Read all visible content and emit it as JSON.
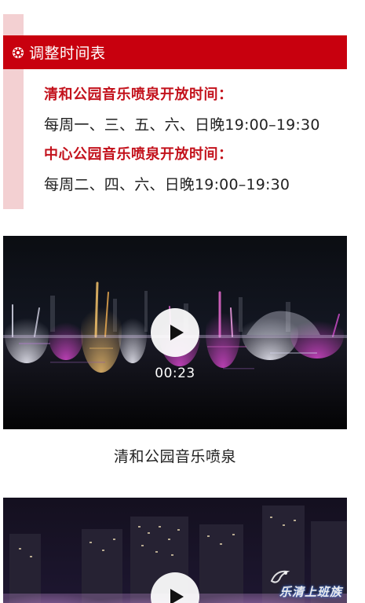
{
  "schedule": {
    "header_title": "调整时间表",
    "header_icon": "gear-icon",
    "venues": [
      {
        "title": "清和公园音乐喷泉开放时间：",
        "hours": "每周一、三、五、六、日晚19:00–19:30"
      },
      {
        "title": "中心公园音乐喷泉开放时间：",
        "hours": "每周二、四、六、日晚19:00–19:30"
      }
    ]
  },
  "videos": [
    {
      "duration": "00:23",
      "caption": "清和公园音乐喷泉"
    },
    {
      "watermark": "乐清上班族"
    }
  ],
  "colors": {
    "accent_red": "#c8000e",
    "title_red": "#c3121c",
    "strip_pink": "#f3d0d2",
    "text_dark": "#222222"
  }
}
